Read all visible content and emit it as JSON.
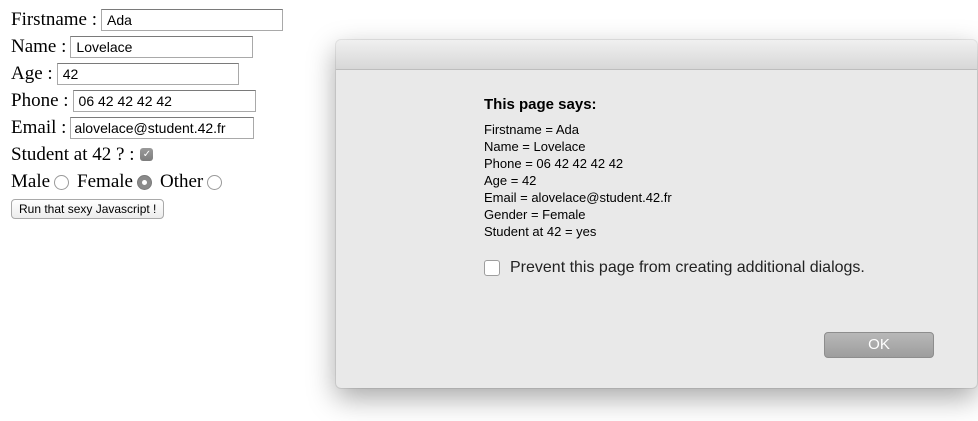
{
  "form": {
    "firstname_label": "Firstname :",
    "firstname_value": "Ada",
    "name_label": "Name :",
    "name_value": "Lovelace",
    "age_label": "Age :",
    "age_value": "42",
    "phone_label": "Phone :",
    "phone_value": "06 42 42 42 42",
    "email_label": "Email :",
    "email_value": "alovelace@student.42.fr",
    "student_label": "Student at 42 ? :",
    "student_checked": true,
    "gender_options": [
      "Male",
      "Female",
      "Other"
    ],
    "gender_selected": "Female",
    "run_button_label": "Run that sexy Javascript !"
  },
  "dialog": {
    "title": "This page says:",
    "lines": [
      "Firstname =  Ada",
      "Name =  Lovelace",
      "Phone = 06 42 42 42 42",
      "Age = 42",
      "Email = alovelace@student.42.fr",
      "Gender =  Female",
      "Student at 42 = yes"
    ],
    "prevent_label": "Prevent this page from creating additional dialogs.",
    "prevent_checked": false,
    "ok_label": "OK"
  },
  "icons": {
    "checkbox_checkmark": "✓"
  }
}
